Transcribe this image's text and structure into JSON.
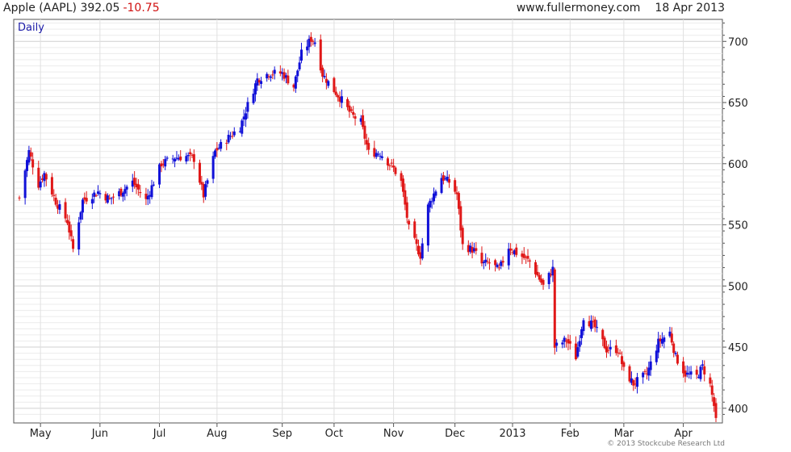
{
  "header": {
    "symbol": "Apple (AAPL)",
    "last": "392.05",
    "change": "-10.75",
    "site": "www.fullermoney.com",
    "date": "18 Apr 2013"
  },
  "period_label": "Daily",
  "copyright": "© 2013 Stockcube Research Ltd",
  "colors": {
    "up": "#1010d8",
    "down": "#e01818",
    "grid": "#d0d0d0",
    "axis": "#555555"
  },
  "chart_data": {
    "type": "candlestick",
    "title": "Apple (AAPL)",
    "period": "Daily",
    "ylim": [
      388,
      718
    ],
    "yticks": [
      400,
      450,
      500,
      550,
      600,
      650,
      700
    ],
    "x_domain": [
      "2012-04-20",
      "2013-04-18"
    ],
    "x_tick_labels": [
      {
        "label": "May",
        "date": "2012-05-01"
      },
      {
        "label": "Jun",
        "date": "2012-06-01"
      },
      {
        "label": "Jul",
        "date": "2012-07-02"
      },
      {
        "label": "Aug",
        "date": "2012-08-01"
      },
      {
        "label": "Sep",
        "date": "2012-09-04"
      },
      {
        "label": "Oct",
        "date": "2012-10-01"
      },
      {
        "label": "Nov",
        "date": "2012-11-01"
      },
      {
        "label": "Dec",
        "date": "2012-12-03"
      },
      {
        "label": "2013",
        "date": "2013-01-02"
      },
      {
        "label": "Feb",
        "date": "2013-02-01"
      },
      {
        "label": "Mar",
        "date": "2013-03-01"
      },
      {
        "label": "Apr",
        "date": "2013-04-01"
      }
    ],
    "close_path": [
      [
        "2012-04-20",
        572
      ],
      [
        "2012-04-25",
        610
      ],
      [
        "2012-04-30",
        583
      ],
      [
        "2012-05-03",
        592
      ],
      [
        "2012-05-09",
        569
      ],
      [
        "2012-05-15",
        553
      ],
      [
        "2012-05-18",
        530
      ],
      [
        "2012-05-23",
        570
      ],
      [
        "2012-05-31",
        577
      ],
      [
        "2012-06-06",
        571
      ],
      [
        "2012-06-12",
        577
      ],
      [
        "2012-06-18",
        585
      ],
      [
        "2012-06-25",
        570
      ],
      [
        "2012-07-03",
        600
      ],
      [
        "2012-07-10",
        605
      ],
      [
        "2012-07-16",
        606
      ],
      [
        "2012-07-20",
        604
      ],
      [
        "2012-07-25",
        574
      ],
      [
        "2012-07-31",
        610
      ],
      [
        "2012-08-06",
        620
      ],
      [
        "2012-08-13",
        630
      ],
      [
        "2012-08-17",
        648
      ],
      [
        "2012-08-22",
        669
      ],
      [
        "2012-08-28",
        674
      ],
      [
        "2012-09-04",
        674
      ],
      [
        "2012-09-10",
        663
      ],
      [
        "2012-09-14",
        690
      ],
      [
        "2012-09-19",
        702
      ],
      [
        "2012-09-21",
        700
      ],
      [
        "2012-09-25",
        673
      ],
      [
        "2012-10-01",
        660
      ],
      [
        "2012-10-05",
        652
      ],
      [
        "2012-10-10",
        640
      ],
      [
        "2012-10-15",
        634
      ],
      [
        "2012-10-19",
        609
      ],
      [
        "2012-10-25",
        609
      ],
      [
        "2012-11-01",
        596
      ],
      [
        "2012-11-05",
        585
      ],
      [
        "2012-11-09",
        547
      ],
      [
        "2012-11-15",
        525
      ],
      [
        "2012-11-19",
        565
      ],
      [
        "2012-11-26",
        589
      ],
      [
        "2012-11-30",
        585
      ],
      [
        "2012-12-04",
        575
      ],
      [
        "2012-12-07",
        533
      ],
      [
        "2012-12-13",
        529
      ],
      [
        "2012-12-17",
        518
      ],
      [
        "2012-12-21",
        519
      ],
      [
        "2012-12-26",
        513
      ],
      [
        "2012-12-31",
        532
      ],
      [
        "2013-01-04",
        527
      ],
      [
        "2013-01-11",
        520
      ],
      [
        "2013-01-18",
        500
      ],
      [
        "2013-01-23",
        514
      ],
      [
        "2013-01-24",
        450
      ],
      [
        "2013-01-30",
        456
      ],
      [
        "2013-02-04",
        442
      ],
      [
        "2013-02-08",
        475
      ],
      [
        "2013-02-14",
        466
      ],
      [
        "2013-02-20",
        448
      ],
      [
        "2013-02-26",
        448
      ],
      [
        "2013-03-01",
        431
      ],
      [
        "2013-03-06",
        420
      ],
      [
        "2013-03-13",
        428
      ],
      [
        "2013-03-19",
        454
      ],
      [
        "2013-03-25",
        462
      ],
      [
        "2013-03-28",
        442
      ],
      [
        "2013-04-02",
        428
      ],
      [
        "2013-04-08",
        426
      ],
      [
        "2013-04-11",
        434
      ],
      [
        "2013-04-15",
        419
      ],
      [
        "2013-04-17",
        402
      ],
      [
        "2013-04-18",
        392
      ]
    ],
    "last_close": 392.05,
    "change": -10.75
  }
}
